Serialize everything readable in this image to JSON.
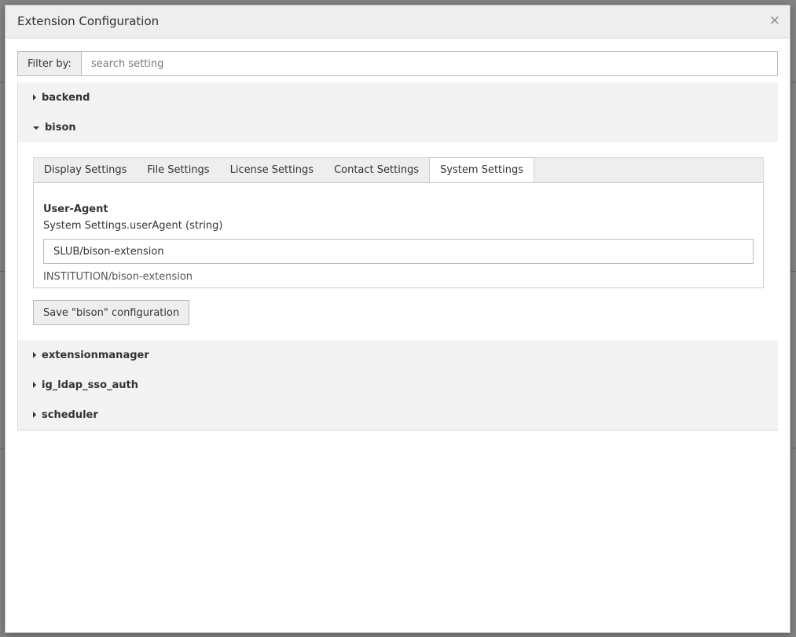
{
  "modal": {
    "title": "Extension Configuration",
    "close_glyph": "×"
  },
  "filter": {
    "label": "Filter by:",
    "placeholder": "search setting",
    "value": ""
  },
  "extensions": [
    {
      "name": "backend",
      "expanded": false
    },
    {
      "name": "bison",
      "expanded": true
    },
    {
      "name": "extensionmanager",
      "expanded": false
    },
    {
      "name": "ig_ldap_sso_auth",
      "expanded": false
    },
    {
      "name": "scheduler",
      "expanded": false
    }
  ],
  "bison": {
    "tabs": [
      {
        "label": "Display Settings",
        "active": false
      },
      {
        "label": "File Settings",
        "active": false
      },
      {
        "label": "License Settings",
        "active": false
      },
      {
        "label": "Contact Settings",
        "active": false
      },
      {
        "label": "System Settings",
        "active": true
      }
    ],
    "setting": {
      "title": "User-Agent",
      "key": "System Settings.userAgent (string)",
      "value": "SLUB/bison-extension",
      "default": "INSTITUTION/bison-extension"
    },
    "save_label": "Save \"bison\" configuration"
  }
}
